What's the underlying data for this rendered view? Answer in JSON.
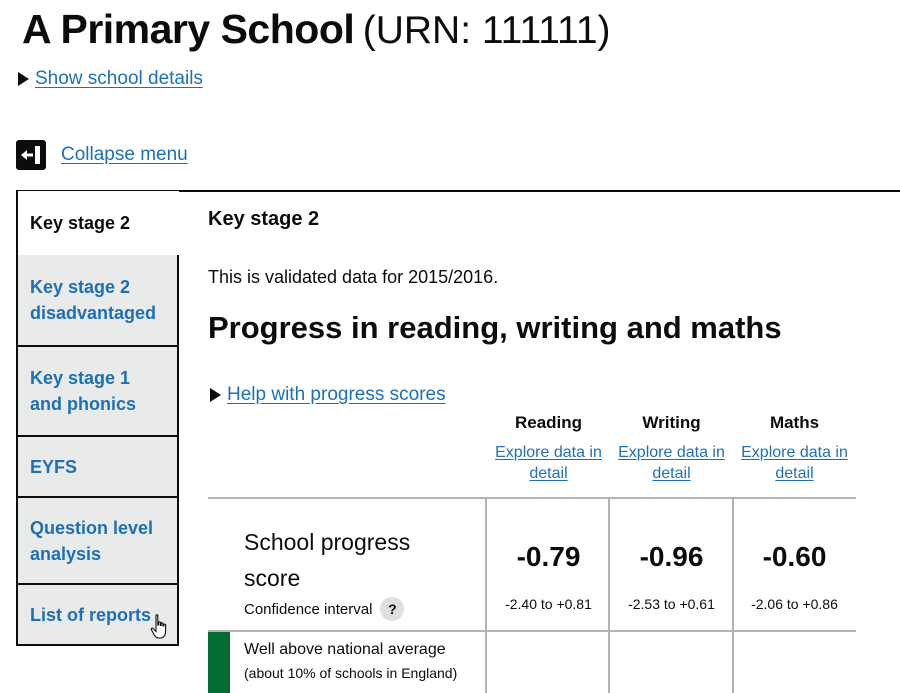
{
  "school": {
    "name": "A Primary School",
    "urn": "(URN: 111111)"
  },
  "details_link": "Show school details",
  "collapse_menu": "Collapse menu",
  "sidebar": {
    "items": [
      {
        "label": "Key stage 2"
      },
      {
        "label": "Key stage 2 disadvantaged"
      },
      {
        "label": "Key stage 1 and phonics"
      },
      {
        "label": "EYFS"
      },
      {
        "label": "Question level analysis"
      },
      {
        "label": "List of reports"
      }
    ]
  },
  "main": {
    "heading": "Key stage 2",
    "validated": "This is validated data for 2015/2016.",
    "title": "Progress in reading, writing and maths",
    "help_link": "Help with progress scores",
    "columns": [
      {
        "name": "Reading",
        "link": "Explore data in detail",
        "score": "-0.79",
        "range": "-2.40 to +0.81"
      },
      {
        "name": "Writing",
        "link": "Explore data in detail",
        "score": "-0.96",
        "range": "-2.53 to +0.61"
      },
      {
        "name": "Maths",
        "link": "Explore data in detail",
        "score": "-0.60",
        "range": "-2.06 to +0.86"
      }
    ],
    "score_label": "School progress score",
    "confidence_interval": "Confidence interval",
    "help_q": "?",
    "band": {
      "title": "Well above national average",
      "subtitle": "(about 10% of schools in England)",
      "color": "#006d31"
    }
  },
  "colors": {
    "link": "#1d70b8",
    "text": "#0b0c0c",
    "tab_bg": "#e9eaea",
    "border": "#b1b4b6"
  }
}
